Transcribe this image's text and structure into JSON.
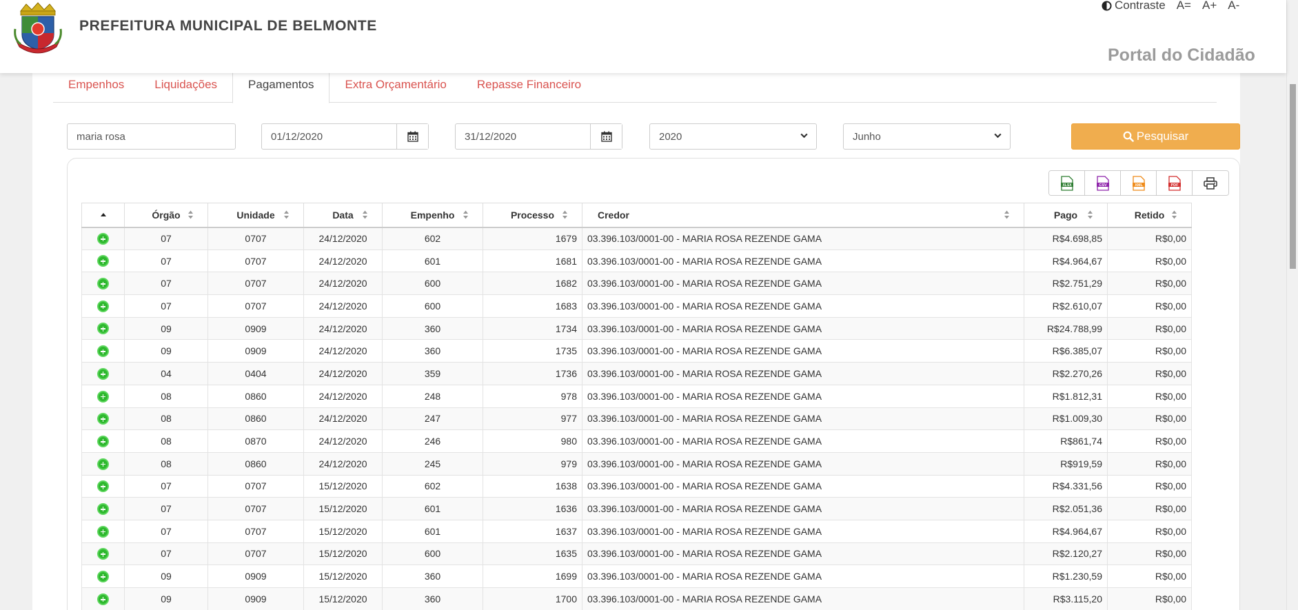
{
  "header": {
    "title": "PREFEITURA MUNICIPAL DE BELMONTE",
    "portal": "Portal do Cidadão",
    "contrast_label": "Contraste",
    "font_reset": "A=",
    "font_increase": "A+",
    "font_decrease": "A-"
  },
  "tabs": [
    {
      "label": "Empenhos",
      "active": false
    },
    {
      "label": "Liquidações",
      "active": false
    },
    {
      "label": "Pagamentos",
      "active": true
    },
    {
      "label": "Extra Orçamentário",
      "active": false
    },
    {
      "label": "Repasse Financeiro",
      "active": false
    }
  ],
  "filters": {
    "credor_value": "maria rosa",
    "date_from": "01/12/2020",
    "date_to": "31/12/2020",
    "year": "2020",
    "month": "Junho",
    "search_label": "Pesquisar"
  },
  "export_icons": [
    "xlsx-icon",
    "csv-icon",
    "xml-icon",
    "pdf-icon",
    "print-icon"
  ],
  "table": {
    "headers": [
      "Órgão",
      "Unidade",
      "Data",
      "Empenho",
      "Processo",
      "Credor",
      "Pago",
      "Retido"
    ],
    "rows": [
      [
        "07",
        "0707",
        "24/12/2020",
        "602",
        "1679",
        "03.396.103/0001-00 - MARIA ROSA REZENDE GAMA",
        "R$4.698,85",
        "R$0,00"
      ],
      [
        "07",
        "0707",
        "24/12/2020",
        "601",
        "1681",
        "03.396.103/0001-00 - MARIA ROSA REZENDE GAMA",
        "R$4.964,67",
        "R$0,00"
      ],
      [
        "07",
        "0707",
        "24/12/2020",
        "600",
        "1682",
        "03.396.103/0001-00 - MARIA ROSA REZENDE GAMA",
        "R$2.751,29",
        "R$0,00"
      ],
      [
        "07",
        "0707",
        "24/12/2020",
        "600",
        "1683",
        "03.396.103/0001-00 - MARIA ROSA REZENDE GAMA",
        "R$2.610,07",
        "R$0,00"
      ],
      [
        "09",
        "0909",
        "24/12/2020",
        "360",
        "1734",
        "03.396.103/0001-00 - MARIA ROSA REZENDE GAMA",
        "R$24.788,99",
        "R$0,00"
      ],
      [
        "09",
        "0909",
        "24/12/2020",
        "360",
        "1735",
        "03.396.103/0001-00 - MARIA ROSA REZENDE GAMA",
        "R$6.385,07",
        "R$0,00"
      ],
      [
        "04",
        "0404",
        "24/12/2020",
        "359",
        "1736",
        "03.396.103/0001-00 - MARIA ROSA REZENDE GAMA",
        "R$2.270,26",
        "R$0,00"
      ],
      [
        "08",
        "0860",
        "24/12/2020",
        "248",
        "978",
        "03.396.103/0001-00 - MARIA ROSA REZENDE GAMA",
        "R$1.812,31",
        "R$0,00"
      ],
      [
        "08",
        "0860",
        "24/12/2020",
        "247",
        "977",
        "03.396.103/0001-00 - MARIA ROSA REZENDE GAMA",
        "R$1.009,30",
        "R$0,00"
      ],
      [
        "08",
        "0870",
        "24/12/2020",
        "246",
        "980",
        "03.396.103/0001-00 - MARIA ROSA REZENDE GAMA",
        "R$861,74",
        "R$0,00"
      ],
      [
        "08",
        "0860",
        "24/12/2020",
        "245",
        "979",
        "03.396.103/0001-00 - MARIA ROSA REZENDE GAMA",
        "R$919,59",
        "R$0,00"
      ],
      [
        "07",
        "0707",
        "15/12/2020",
        "602",
        "1638",
        "03.396.103/0001-00 - MARIA ROSA REZENDE GAMA",
        "R$4.331,56",
        "R$0,00"
      ],
      [
        "07",
        "0707",
        "15/12/2020",
        "601",
        "1636",
        "03.396.103/0001-00 - MARIA ROSA REZENDE GAMA",
        "R$2.051,36",
        "R$0,00"
      ],
      [
        "07",
        "0707",
        "15/12/2020",
        "601",
        "1637",
        "03.396.103/0001-00 - MARIA ROSA REZENDE GAMA",
        "R$4.964,67",
        "R$0,00"
      ],
      [
        "07",
        "0707",
        "15/12/2020",
        "600",
        "1635",
        "03.396.103/0001-00 - MARIA ROSA REZENDE GAMA",
        "R$2.120,27",
        "R$0,00"
      ],
      [
        "09",
        "0909",
        "15/12/2020",
        "360",
        "1699",
        "03.396.103/0001-00 - MARIA ROSA REZENDE GAMA",
        "R$1.230,59",
        "R$0,00"
      ],
      [
        "09",
        "0909",
        "15/12/2020",
        "360",
        "1700",
        "03.396.103/0001-00 - MARIA ROSA REZENDE GAMA",
        "R$3.115,20",
        "R$0,00"
      ]
    ]
  },
  "colors": {
    "tab_link": "#d9534f",
    "search_button": "#f0ad4e",
    "expand_icon": "#2eb82e"
  }
}
